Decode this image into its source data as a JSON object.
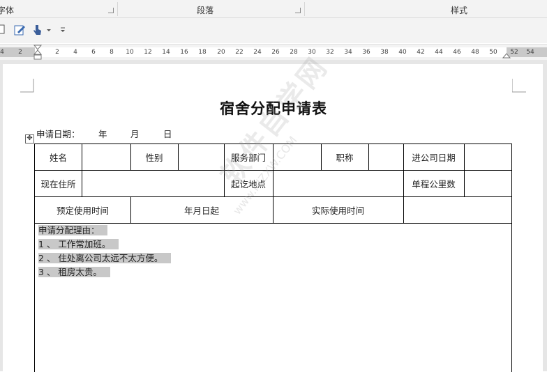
{
  "ribbon": {
    "groups": [
      "字体",
      "段落",
      "样式"
    ]
  },
  "quick_access": {
    "icons": [
      "new-page-icon",
      "edit-icon",
      "touch-mode-icon",
      "dropdown-icon",
      "customize-icon"
    ]
  },
  "ruler": {
    "ticks": [
      "4",
      "2",
      "2",
      "4",
      "6",
      "8",
      "10",
      "12",
      "14",
      "16",
      "18",
      "20",
      "22",
      "24",
      "26",
      "28",
      "30",
      "32",
      "34",
      "36",
      "38",
      "40",
      "42",
      "44",
      "46",
      "48",
      "50",
      "52",
      "54"
    ]
  },
  "document": {
    "title": "宿舍分配申请表",
    "date_label": "申请日期：",
    "date_year": "年",
    "date_month": "月",
    "date_day": "日",
    "watermark": "软件自学网",
    "watermark_url": "www.RJZXW.COM",
    "table": {
      "row1": [
        "姓名",
        "性别",
        "服务部门",
        "职称",
        "进公司日期"
      ],
      "row2": [
        "现在住所",
        "起讫地点",
        "单程公里数"
      ],
      "row3": [
        "预定使用时间",
        "年月日起",
        "实际使用时间"
      ],
      "reason_title": "申请分配理由：",
      "reasons": [
        "1 、 工作常加班。",
        "2 、 住处离公司太远不太方便。",
        "3 、 租房太贵。"
      ]
    }
  }
}
